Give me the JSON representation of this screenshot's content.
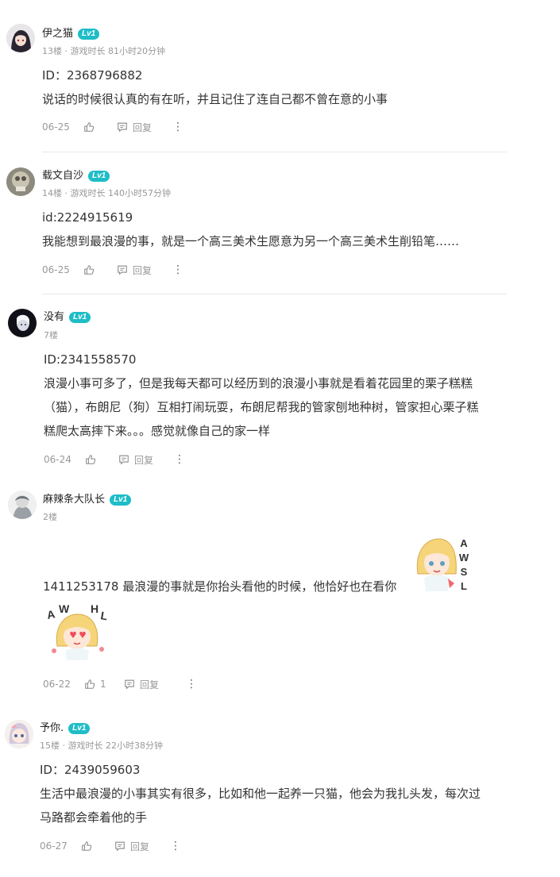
{
  "level_badge": "Lv1",
  "reply_label": "回复",
  "more_label": "⋮",
  "comments": [
    {
      "name": "伊之猫",
      "meta": "13楼 · 游戏时长 81小时20分钟",
      "lines": [
        "ID：2368796882",
        "说话的时候很认真的有在听，并且记住了连自己都不曾在意的小事"
      ],
      "date": "06-25",
      "likes": ""
    },
    {
      "name": "载文自沙",
      "meta": "14楼 · 游戏时长 140小时57分钟",
      "lines": [
        "id:2224915619",
        "我能想到最浪漫的事，就是一个高三美术生愿意为另一个高三美术生削铅笔……"
      ],
      "date": "06-25",
      "likes": ""
    },
    {
      "name": "没有",
      "meta": "7楼",
      "lines": [
        "ID:2341558570",
        "浪漫小事可多了，但是我每天都可以经历到的浪漫小事就是看着花园里的栗子糕糕",
        "（猫），布朗尼（狗）互相打闹玩耍，布朗尼帮我的管家刨地种树，管家担心栗子糕",
        "糕爬太高摔下来。。。感觉就像自己的家一样"
      ],
      "date": "06-24",
      "likes": ""
    },
    {
      "name": "麻辣条大队长",
      "meta": "2楼",
      "lines": [
        "1411253178 最浪漫的事就是你抬头看他的时候，他恰好也在看你"
      ],
      "sticker1_text": "AWSL",
      "sticker2_text": "AWHL",
      "date": "06-22",
      "likes": "1"
    },
    {
      "name": "予你.",
      "meta": "15楼 · 游戏时长 22小时38分钟",
      "lines": [
        "ID：2439059603",
        "生活中最浪漫的小事其实有很多，比如和他一起养一只猫，他会为我扎头发，每次过",
        "马路都会牵着他的手"
      ],
      "date": "06-27",
      "likes": ""
    }
  ]
}
